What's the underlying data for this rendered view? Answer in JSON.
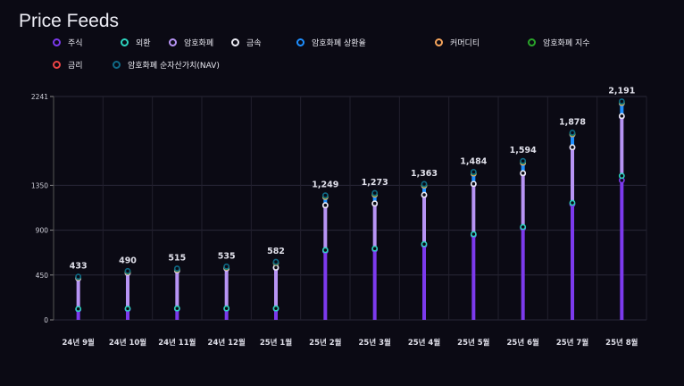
{
  "title": "Price Feeds",
  "chart_data": {
    "type": "bar",
    "stacked": true,
    "title": "Price Feeds",
    "categories": [
      "24년 9월",
      "24년 10월",
      "24년 11월",
      "24년 12월",
      "25년 1월",
      "25년 2월",
      "25년 3월",
      "25년 4월",
      "25년 5월",
      "25년 6월",
      "25년 7월",
      "25년 8월"
    ],
    "totals": [
      433,
      490,
      515,
      535,
      582,
      1249,
      1273,
      1363,
      1484,
      1594,
      1878,
      2191
    ],
    "total_labels": [
      "433",
      "490",
      "515",
      "535",
      "582",
      "1,249",
      "1,273",
      "1,363",
      "1,484",
      "1,594",
      "1,878",
      "2,191"
    ],
    "yticks": [
      0,
      450,
      900,
      1350,
      2241
    ],
    "ylim": [
      0,
      2241
    ],
    "grid": true,
    "legend_position": "top",
    "series": [
      {
        "name": "주식",
        "color": "#7c3aed",
        "values": [
          105,
          108,
          110,
          110,
          110,
          690,
          705,
          750,
          850,
          920,
          1160,
          1400
        ]
      },
      {
        "name": "외환",
        "color": "#2dd4bf",
        "values": [
          5,
          5,
          5,
          5,
          5,
          10,
          10,
          10,
          10,
          12,
          14,
          45
        ]
      },
      {
        "name": "암호화폐",
        "color": "#b794f4",
        "values": [
          305,
          355,
          378,
          398,
          405,
          445,
          448,
          490,
          500,
          535,
          553,
          595
        ]
      },
      {
        "name": "금속",
        "color": "#ededf5",
        "values": [
          3,
          5,
          5,
          5,
          5,
          5,
          5,
          5,
          5,
          5,
          5,
          5
        ]
      },
      {
        "name": "암호화폐 상환율",
        "color": "#1e8fff",
        "values": [
          5,
          5,
          5,
          5,
          45,
          80,
          85,
          88,
          99,
          100,
          125,
          125
        ]
      },
      {
        "name": "커머디티",
        "color": "#f6a55c",
        "values": [
          2,
          2,
          2,
          2,
          2,
          4,
          5,
          5,
          5,
          6,
          6,
          6
        ]
      },
      {
        "name": "암호화폐 지수",
        "color": "#2aa52a",
        "values": [
          5,
          6,
          6,
          6,
          6,
          10,
          10,
          10,
          10,
          11,
          10,
          10
        ]
      },
      {
        "name": "금리",
        "color": "#ef4444",
        "values": [
          0,
          0,
          0,
          0,
          0,
          0,
          0,
          0,
          0,
          0,
          0,
          0
        ]
      },
      {
        "name": "암호화폐 순자산가치(NAV)",
        "color": "#0e6b87",
        "values": [
          3,
          4,
          4,
          4,
          4,
          5,
          5,
          5,
          5,
          5,
          5,
          5
        ]
      }
    ]
  }
}
